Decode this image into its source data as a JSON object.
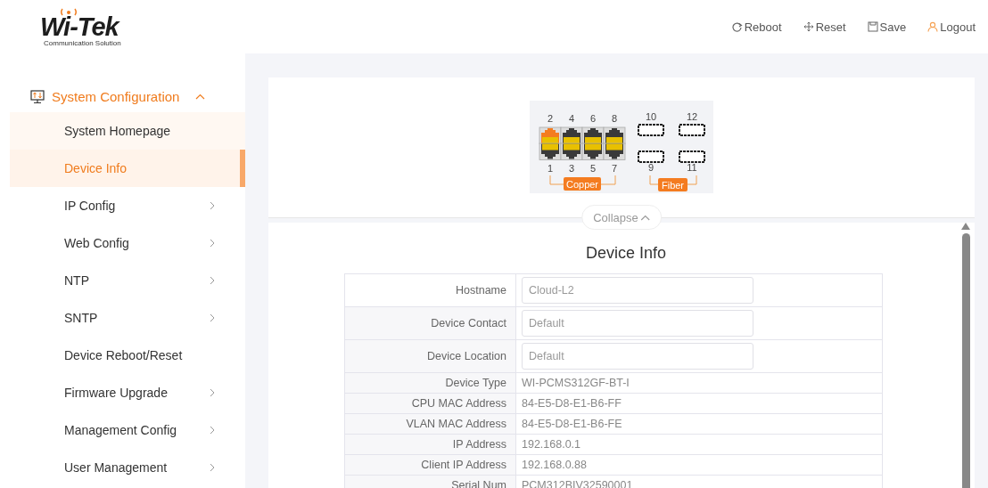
{
  "header": {
    "logo": {
      "name": "Wi-Tek",
      "tagline": "Communication Solution"
    },
    "actions": [
      {
        "kind": "reboot",
        "label": "Reboot"
      },
      {
        "kind": "reset",
        "label": "Reset"
      },
      {
        "kind": "save",
        "label": "Save"
      },
      {
        "kind": "logout",
        "label": "Logout"
      }
    ]
  },
  "sidebar": {
    "group": {
      "label": "System Configuration",
      "expanded": true,
      "items": [
        {
          "label": "System Homepage",
          "selected": false,
          "hovered": true,
          "has_submenu": false
        },
        {
          "label": "Device Info",
          "selected": true,
          "hovered": false,
          "has_submenu": false
        },
        {
          "label": "IP Config",
          "selected": false,
          "hovered": false,
          "has_submenu": true
        },
        {
          "label": "Web Config",
          "selected": false,
          "hovered": false,
          "has_submenu": true
        },
        {
          "label": "NTP",
          "selected": false,
          "hovered": false,
          "has_submenu": true
        },
        {
          "label": "SNTP",
          "selected": false,
          "hovered": false,
          "has_submenu": true
        },
        {
          "label": "Device Reboot/Reset",
          "selected": false,
          "hovered": false,
          "has_submenu": false
        },
        {
          "label": "Firmware Upgrade",
          "selected": false,
          "hovered": false,
          "has_submenu": true
        },
        {
          "label": "Management Config",
          "selected": false,
          "hovered": false,
          "has_submenu": true
        },
        {
          "label": "User Management",
          "selected": false,
          "hovered": false,
          "has_submenu": true
        }
      ]
    }
  },
  "panel": {
    "copper_label": "Copper",
    "fiber_label": "Fiber",
    "copper_ports": [
      {
        "label": "2",
        "up": true
      },
      {
        "label": "4",
        "up": false
      },
      {
        "label": "6",
        "up": false
      },
      {
        "label": "8",
        "up": false
      },
      {
        "label": "1",
        "up": false
      },
      {
        "label": "3",
        "up": false
      },
      {
        "label": "5",
        "up": false
      },
      {
        "label": "7",
        "up": false
      }
    ],
    "fiber_ports": [
      {
        "label": "10"
      },
      {
        "label": "12"
      },
      {
        "label": "9"
      },
      {
        "label": "11"
      }
    ],
    "collapse_button": "Collapse"
  },
  "device_info": {
    "title": "Device Info",
    "rows": [
      {
        "kind": "input",
        "label": "Hostname",
        "value": "Cloud-L2"
      },
      {
        "kind": "input",
        "label": "Device Contact",
        "value": "Default"
      },
      {
        "kind": "input",
        "label": "Device Location",
        "value": "Default"
      },
      {
        "kind": "text",
        "label": "Device Type",
        "value": "WI-PCMS312GF-BT-I"
      },
      {
        "kind": "text",
        "label": "CPU MAC Address",
        "value": "84-E5-D8-E1-B6-FF"
      },
      {
        "kind": "text",
        "label": "VLAN MAC Address",
        "value": "84-E5-D8-E1-B6-FE"
      },
      {
        "kind": "text",
        "label": "IP Address",
        "value": "192.168.0.1"
      },
      {
        "kind": "text",
        "label": "Client IP Address",
        "value": "192.168.0.88"
      },
      {
        "kind": "text",
        "label": "Serial Num",
        "value": "PCM312BIV32590001"
      }
    ]
  }
}
